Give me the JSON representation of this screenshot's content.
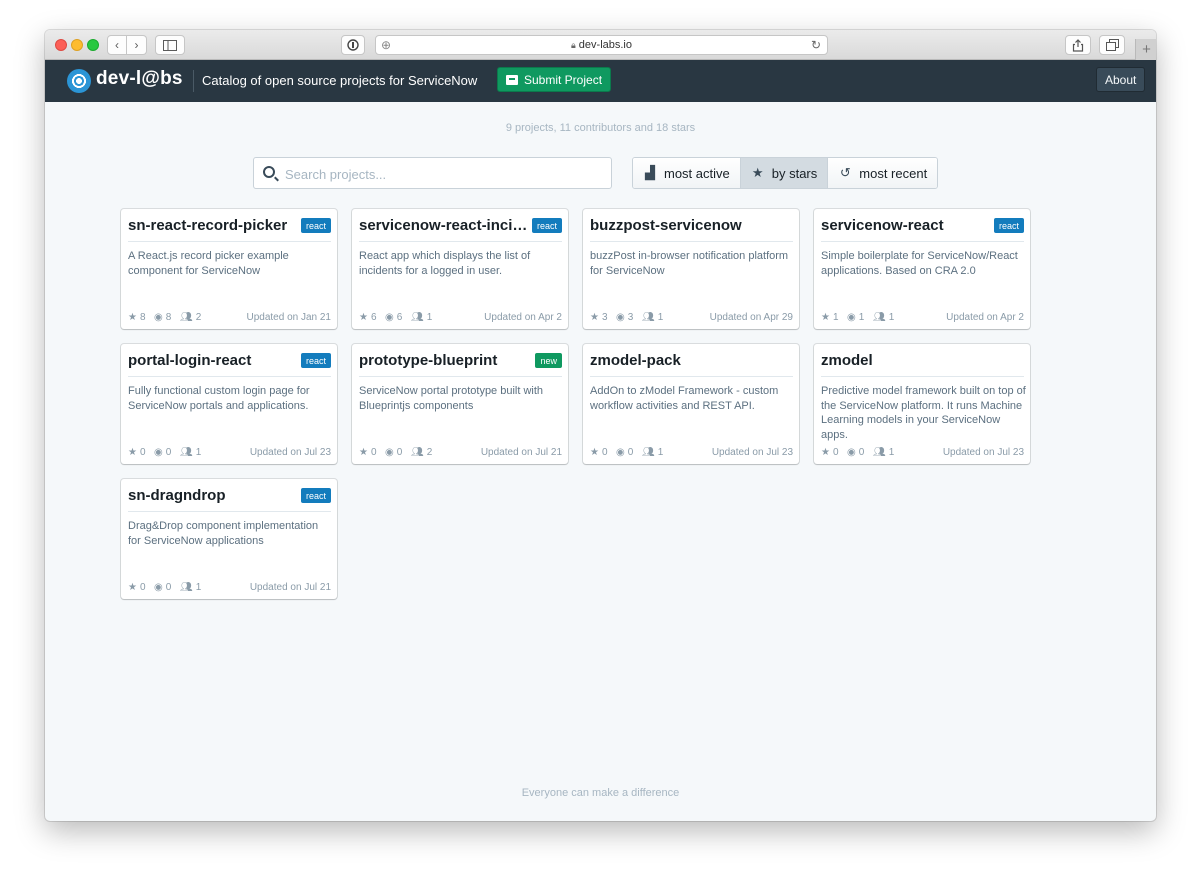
{
  "browser": {
    "url": "dev-labs.io",
    "back_glyph": "‹",
    "forward_glyph": "›",
    "newtab_glyph": "+"
  },
  "navbar": {
    "brand": "dev-l@bs",
    "tagline": "Catalog of open source projects for ServiceNow",
    "submit_label": "Submit Project",
    "about_label": "About",
    "accent_color": "#0f9960",
    "bg_color": "#293742"
  },
  "stats": "9 projects, 11 contributors and 18 stars",
  "search": {
    "placeholder": "Search projects..."
  },
  "sort": [
    {
      "label": "most active",
      "icon": "bar-chart-icon",
      "glyph": "▟"
    },
    {
      "label": "by stars",
      "icon": "star-icon",
      "glyph": "★",
      "active": true
    },
    {
      "label": "most recent",
      "icon": "history-icon",
      "glyph": "↺"
    }
  ],
  "projects": [
    {
      "title": "sn-react-record-picker",
      "tag": "react",
      "desc": "A React.js record picker example component for ServiceNow",
      "stars": "8",
      "watchers": "8",
      "contributors": "2",
      "updated": "Updated on Jan 21"
    },
    {
      "title": "servicenow-react-incidents",
      "tag": "react",
      "desc": "React app which displays the list of incidents for a logged in user.",
      "stars": "6",
      "watchers": "6",
      "contributors": "1",
      "updated": "Updated on Apr 2"
    },
    {
      "title": "buzzpost-servicenow",
      "tag": "",
      "desc": "buzzPost in-browser notification platform for ServiceNow",
      "stars": "3",
      "watchers": "3",
      "contributors": "1",
      "updated": "Updated on Apr 29"
    },
    {
      "title": "servicenow-react",
      "tag": "react",
      "desc": "Simple boilerplate for ServiceNow/React applications. Based on CRA 2.0",
      "stars": "1",
      "watchers": "1",
      "contributors": "1",
      "updated": "Updated on Apr 2"
    },
    {
      "title": "portal-login-react",
      "tag": "react",
      "desc": "Fully functional custom login page for ServiceNow portals and applications.",
      "stars": "0",
      "watchers": "0",
      "contributors": "1",
      "updated": "Updated on Jul 23"
    },
    {
      "title": "prototype-blueprint",
      "tag": "new",
      "desc": "ServiceNow portal prototype built with Blueprintjs components",
      "stars": "0",
      "watchers": "0",
      "contributors": "2",
      "updated": "Updated on Jul 21"
    },
    {
      "title": "zmodel-pack",
      "tag": "",
      "desc": "AddOn to zModel Framework - custom workflow activities and REST API.",
      "stars": "0",
      "watchers": "0",
      "contributors": "1",
      "updated": "Updated on Jul 23"
    },
    {
      "title": "zmodel",
      "tag": "",
      "desc": "Predictive model framework built on top of the ServiceNow platform. It runs Machine Learning models in your ServiceNow apps.",
      "stars": "0",
      "watchers": "0",
      "contributors": "1",
      "updated": "Updated on Jul 23"
    },
    {
      "title": "sn-dragndrop",
      "tag": "react",
      "desc": "Drag&Drop component implementation for ServiceNow applications",
      "stars": "0",
      "watchers": "0",
      "contributors": "1",
      "updated": "Updated on Jul 21"
    }
  ],
  "tag_colors": {
    "react": "#137cbd",
    "new": "#0f9960"
  },
  "footer": "Everyone can make a difference"
}
